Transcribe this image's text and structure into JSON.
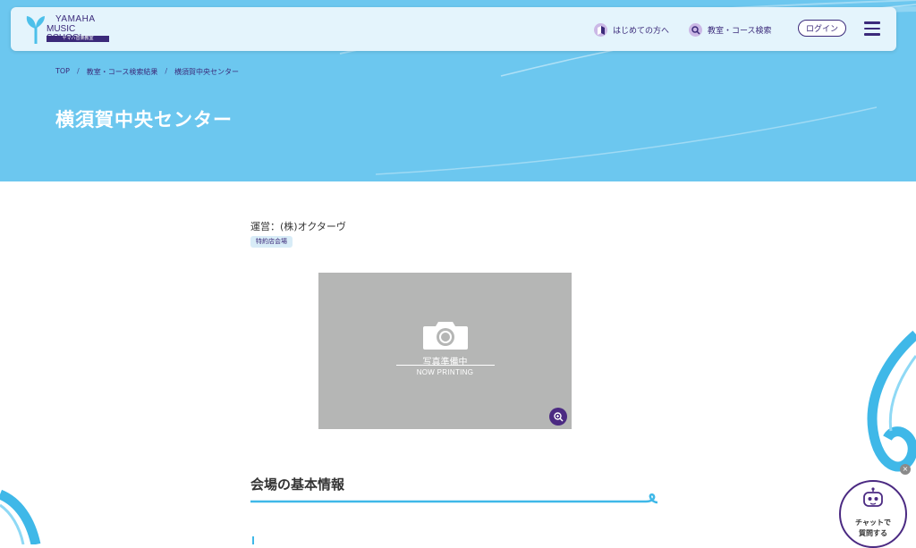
{
  "header": {
    "logo_line1": "YAMAHA",
    "logo_line2": "MUSIC SCHOOL",
    "logo_sub": "ヤマハ音楽教室",
    "nav_first": "はじめての方へ",
    "nav_search": "教室・コース検索",
    "login_label": "ログイン"
  },
  "breadcrumb": {
    "items": [
      "TOP",
      "教室・コース検索結果",
      "横須賀中央センター"
    ],
    "separator": "/"
  },
  "page": {
    "title": "横須賀中央センター",
    "operator": "運営：(株)オクターヴ",
    "tag": "特約店会場"
  },
  "photo": {
    "caption_ja": "写真準備中",
    "caption_en": "NOW PRINTING"
  },
  "section": {
    "title": "会場の基本情報"
  },
  "chat": {
    "line1": "チャットで",
    "line2": "質問する",
    "close": "×"
  },
  "colors": {
    "hero": "#6cc7ef",
    "brand": "#3b2a7a",
    "accent_line": "#3fb8e8",
    "photo_bg": "#b5b6b5"
  },
  "icons": [
    "beginner-leaf-icon",
    "search-icon",
    "hamburger-menu-icon",
    "camera-icon",
    "zoom-in-icon",
    "chat-robot-icon",
    "close-icon"
  ]
}
